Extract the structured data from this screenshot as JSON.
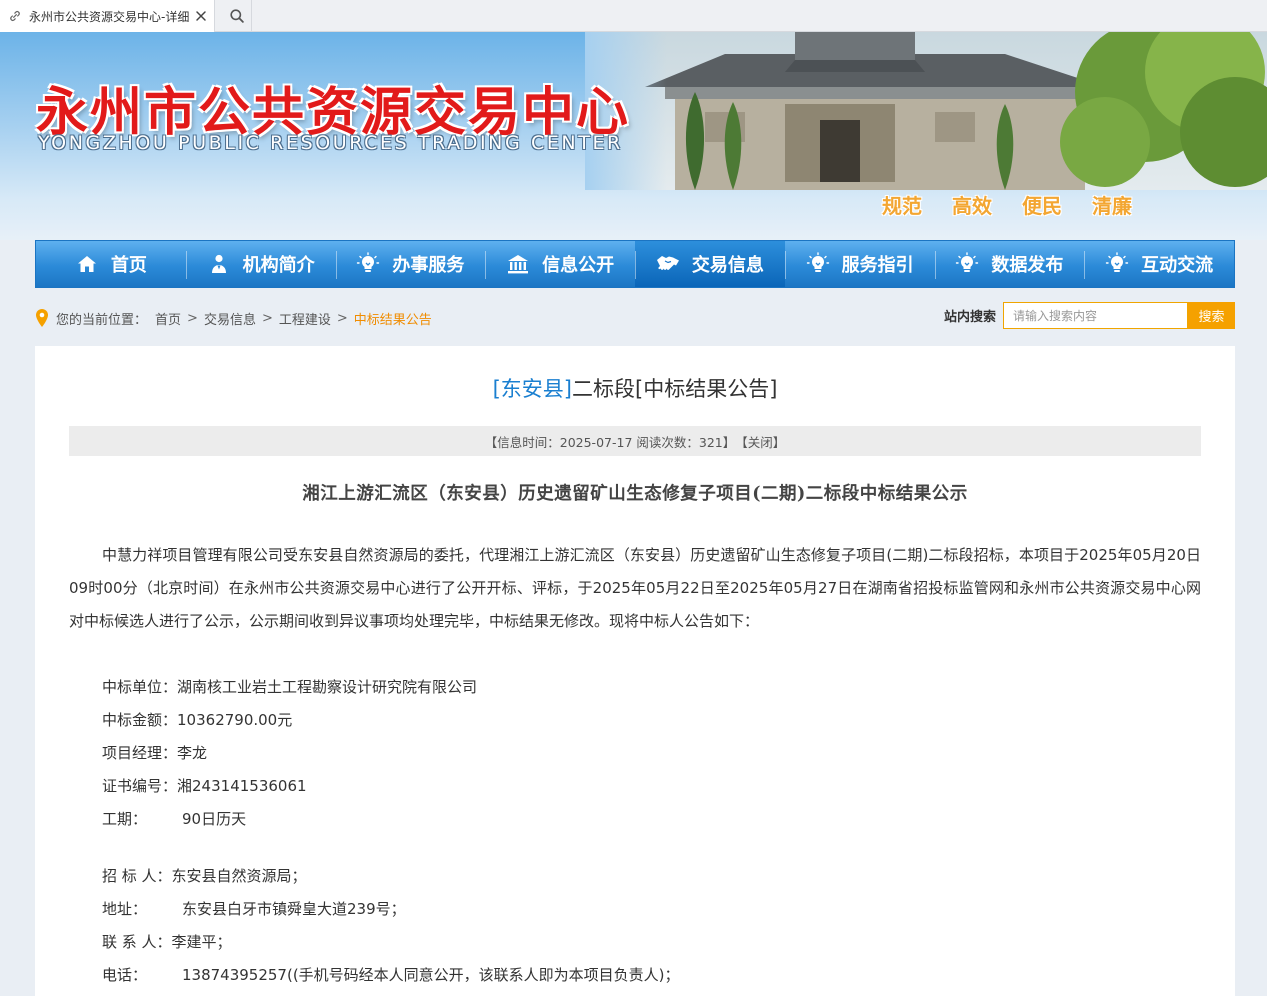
{
  "browser": {
    "tab_title": "永州市公共资源交易中心-详细",
    "icons": {
      "tab": "link-icon",
      "close": "close-icon",
      "search": "search-icon"
    }
  },
  "header": {
    "title": "永州市公共资源交易中心",
    "subtitle": "YONGZHOU PUBLIC RESOURCES TRADING CENTER",
    "slogans": [
      "规范",
      "高效",
      "便民",
      "清廉"
    ],
    "colors": {
      "title": "#e21a1a",
      "slogan": "#f3a632",
      "nav": "#2b8ad8"
    }
  },
  "nav": {
    "items": [
      {
        "label": "首页",
        "icon": "home-icon"
      },
      {
        "label": "机构简介",
        "icon": "person-icon"
      },
      {
        "label": "办事服务",
        "icon": "bulb-icon"
      },
      {
        "label": "信息公开",
        "icon": "building-icon"
      },
      {
        "label": "交易信息",
        "icon": "handshake-icon",
        "active": true
      },
      {
        "label": "服务指引",
        "icon": "bulb-icon"
      },
      {
        "label": "数据发布",
        "icon": "bulb-icon"
      },
      {
        "label": "互动交流",
        "icon": "bulb-icon"
      }
    ]
  },
  "breadcrumb": {
    "prefix": "您的当前位置：",
    "items": [
      "首页",
      "交易信息",
      "工程建设"
    ],
    "current": "中标结果公告",
    "separator": ">"
  },
  "search": {
    "label": "站内搜索",
    "placeholder": "请输入搜索内容",
    "button": "搜索"
  },
  "article": {
    "title_county": "[东安县]",
    "title_rest": "二标段[中标结果公告]",
    "meta_info": "【信息时间：2025-07-17 阅读次数：321】",
    "meta_close": "【关闭】",
    "heading": "湘江上游汇流区（东安县）历史遗留矿山生态修复子项目(二期)二标段中标结果公示",
    "body": "中慧力祥项目管理有限公司受东安县自然资源局的委托，代理湘江上游汇流区（东安县）历史遗留矿山生态修复子项目(二期)二标段招标，本项目于2025年05月20日09时00分（北京时间）在永州市公共资源交易中心进行了公开开标、评标，于2025年05月22日至2025年05月27日在湖南省招投标监管网和永州市公共资源交易中心网对中标候选人进行了公示，公示期间收到异议事项均处理完毕，中标结果无修改。现将中标人公告如下：",
    "winner": [
      {
        "label": "中标单位：",
        "value": "湖南核工业岩土工程勘察设计研究院有限公司"
      },
      {
        "label": "中标金额：",
        "value": "10362790.00元"
      },
      {
        "label": "项目经理：",
        "value": "李龙"
      },
      {
        "label": "证书编号：",
        "value": "湘243141536061"
      },
      {
        "label_a": "工",
        "label_b": "期：",
        "value": "90日历天"
      }
    ],
    "tenderer": [
      {
        "label": "招 标 人：",
        "value": "东安县自然资源局；"
      },
      {
        "label_a": "地",
        "label_b": "址：",
        "value": "东安县白牙市镇舜皇大道239号；"
      },
      {
        "label": "联 系 人：",
        "value": "李建平；"
      },
      {
        "label_a": "电",
        "label_b": "话：",
        "value": "13874395257((手机号码经本人同意公开，该联系人即为本项目负责人)；"
      }
    ]
  }
}
